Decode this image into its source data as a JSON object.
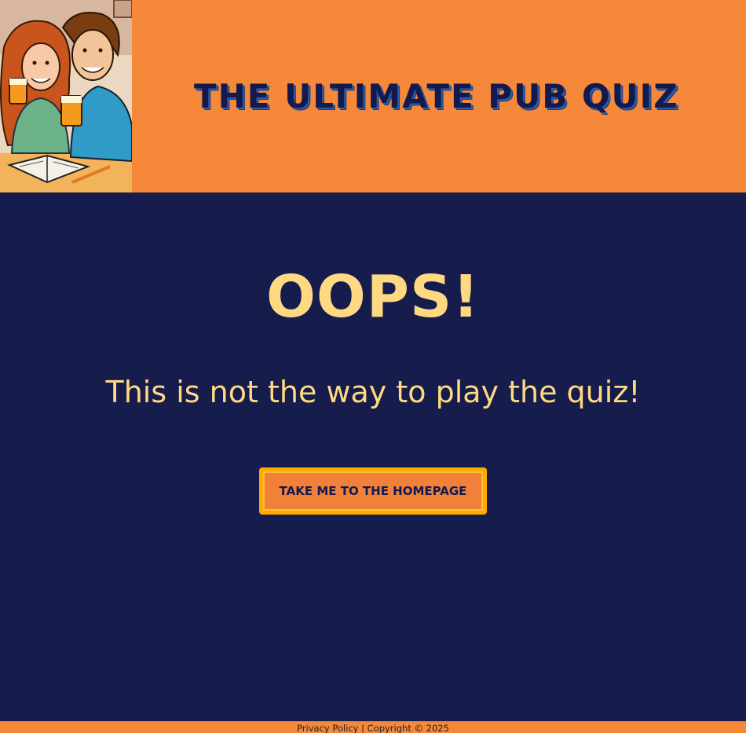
{
  "header": {
    "title": "THE ULTIMATE PUB QUIZ",
    "logo_icon": "couple-drinking-illustration"
  },
  "main": {
    "heading": "OOPS!",
    "message": "This is not the way to play the quiz!",
    "home_button_label": "TAKE ME TO THE HOMEPAGE"
  },
  "footer": {
    "privacy_label": "Privacy Policy",
    "separator": "|",
    "copyright": "Copyright © 2025"
  },
  "colors": {
    "header_bg": "#f6883a",
    "main_bg": "#161c4c",
    "accent_text": "#ffd982",
    "button_border": "#ffaa00"
  }
}
